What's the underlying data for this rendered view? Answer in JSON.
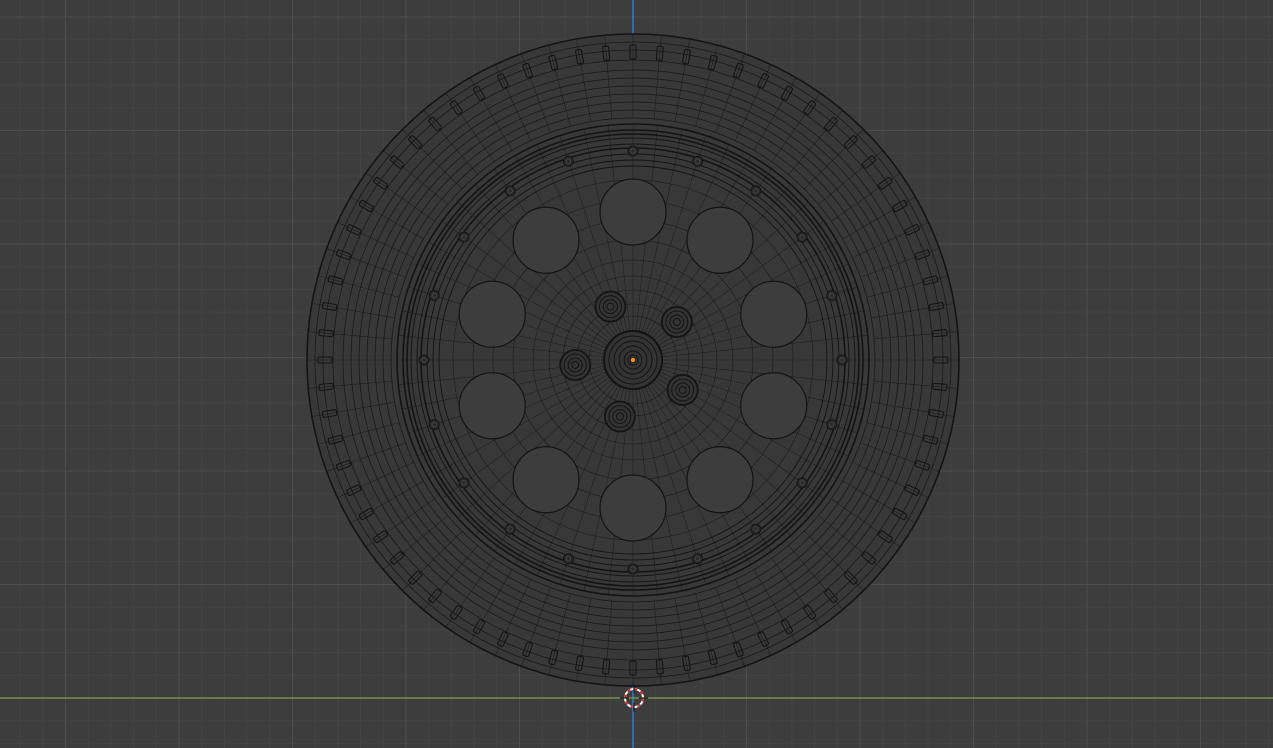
{
  "viewport": {
    "view": "front-orthographic",
    "shading": "wireframe",
    "background_color": "#3d3d3d",
    "grid_minor_color": "#444444",
    "grid_major_color": "#4d4d4d",
    "x_axis_color": "#7fa34a",
    "z_axis_color": "#3a83c9",
    "wire_color": "#141414",
    "origin_color": "#ff8c1a",
    "cursor_color": "#c83232"
  },
  "object": {
    "type": "wheel",
    "tire_tread_blocks": 72,
    "rim_bolts": 20,
    "rim_holes": 10,
    "lug_nuts": 5
  },
  "icons": {
    "cursor": "3d-cursor-icon",
    "origin": "object-origin-icon"
  }
}
